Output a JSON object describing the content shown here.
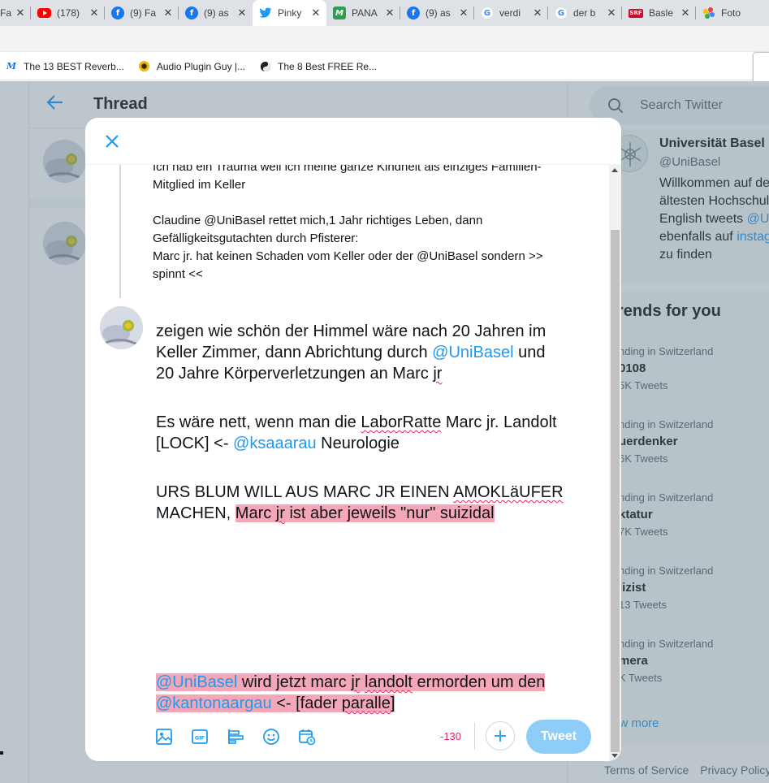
{
  "browser": {
    "tabs": [
      {
        "title": "Fa",
        "icon": "generic-favicon",
        "color": "#5f6368"
      },
      {
        "title": "(178)",
        "icon": "youtube-icon",
        "color": "#ff0000"
      },
      {
        "title": "(9) Fa",
        "icon": "facebook-icon",
        "color": "#1877f2"
      },
      {
        "title": "(9) as",
        "icon": "facebook-icon",
        "color": "#1877f2"
      },
      {
        "title": "Pinky",
        "icon": "twitter-icon",
        "color": "#1d9bf0",
        "active": true
      },
      {
        "title": "PANA",
        "icon": "pana-icon",
        "color": "#2e9e4f"
      },
      {
        "title": "(9) as",
        "icon": "facebook-icon",
        "color": "#1877f2"
      },
      {
        "title": "verdi",
        "icon": "google-icon",
        "color": "#4285f4"
      },
      {
        "title": "der b",
        "icon": "google-icon",
        "color": "#4285f4"
      },
      {
        "title": "Basle",
        "icon": "srf-icon",
        "color": "#c8102e"
      },
      {
        "title": "Foto",
        "icon": "photos-icon",
        "color": "#fbbc04"
      }
    ],
    "bookmarks": [
      {
        "label": "The 13 BEST Reverb...",
        "icon": "m-logo-icon"
      },
      {
        "label": "Audio Plugin Guy |...",
        "icon": "plugin-guy-icon"
      },
      {
        "label": "The 8 Best FREE Re...",
        "icon": "yinyang-icon"
      }
    ]
  },
  "thread": {
    "title": "Thread"
  },
  "sidebar": {
    "search_placeholder": "Search Twitter",
    "profile": {
      "name": "Universität Basel",
      "handle": "@UniBasel",
      "bio_line1": "Willkommen auf de",
      "bio_line2": "ältesten Hochschul",
      "bio_line3_pre": "English tweets ",
      "bio_line3_link": "@U",
      "bio_line4_pre": "ebenfalls auf ",
      "bio_line4_link": "instag",
      "bio_line5": "zu finden"
    },
    "trends_title": "rends for you",
    "trends": [
      {
        "context": "nding in Switzerland",
        "name": "0108",
        "count": "5K Tweets"
      },
      {
        "context": "nding in Switzerland",
        "name": "uerdenker",
        "count": "6K Tweets"
      },
      {
        "context": "nding in Switzerland",
        "name": "ktatur",
        "count": "7K Tweets"
      },
      {
        "context": "nding in Switzerland",
        "name": "lizist",
        "count": "13 Tweets"
      },
      {
        "context": "nding in Switzerland",
        "name": "mera",
        "count": "K Tweets"
      }
    ],
    "show_more": "ow more",
    "footer": {
      "terms": "Terms of Service",
      "privacy": "Privacy Policy"
    }
  },
  "modal": {
    "quoted_lines": {
      "l1": "Ich hab ein Trauma weil ich meine ganze Kindheit als einziges Familien-",
      "l2": "Mitglied im Keller",
      "l3": "Claudine @UniBasel rettet mich,1 Jahr richtiges Leben, dann",
      "l4": "Gefälligkeitsgutachten durch Pfisterer:",
      "l5": "Marc jr. hat keinen Schaden vom Keller oder der @UniBasel sondern >>",
      "l6": "spinnt <<"
    },
    "compose": {
      "p1_l1": "zeigen wie schön der Himmel wäre nach 20 Jahren im",
      "p1_l2_pre": "Keller Zimmer, dann Abrichtung durch ",
      "p1_l2_link": "@UniBasel",
      "p1_l2_post": " und",
      "p1_l3_pre": "20 Jahre Körperverletzungen an Marc ",
      "p1_l3_sq": "jr",
      "p2_l1_pre": "Es wäre nett, wenn man die ",
      "p2_l1_sq": "LaborRatte",
      "p2_l1_post": " Marc jr. Landolt",
      "p2_l2_pre": "[LOCK] <- ",
      "p2_l2_link": "@ksaaarau",
      "p2_l2_post": " Neurologie",
      "p3_l1_pre": "URS BLUM WILL AUS MARC JR EINEN ",
      "p3_l1_sq": "AMOKLäUFER",
      "p3_l2_pre": "MACHEN, ",
      "p3_l2_hl_a": "Marc ",
      "p3_l2_hl_sq": "jr",
      "p3_l2_hl_b": " ist aber jeweils \"nur\" suizidal",
      "p4_l1_link": "@UniBasel",
      "p4_l1_a": " wird jetzt marc ",
      "p4_l1_sq1": "jr",
      "p4_l1_b": " ",
      "p4_l1_sq2": "landolt",
      "p4_l1_c": " ermorden um den",
      "p4_l2_link": "@kantonaargau",
      "p4_l2_a": " <- [fader ",
      "p4_l2_sq": "paralle",
      "p4_l2_b": "]"
    },
    "toolbar": {
      "counter": "-130",
      "tweet_label": "Tweet"
    }
  },
  "colors": {
    "accent": "#1d9bf0",
    "highlight": "#f4a7b6",
    "counter_over": "#e0245e",
    "tweet_disabled": "#8ecdf8"
  }
}
